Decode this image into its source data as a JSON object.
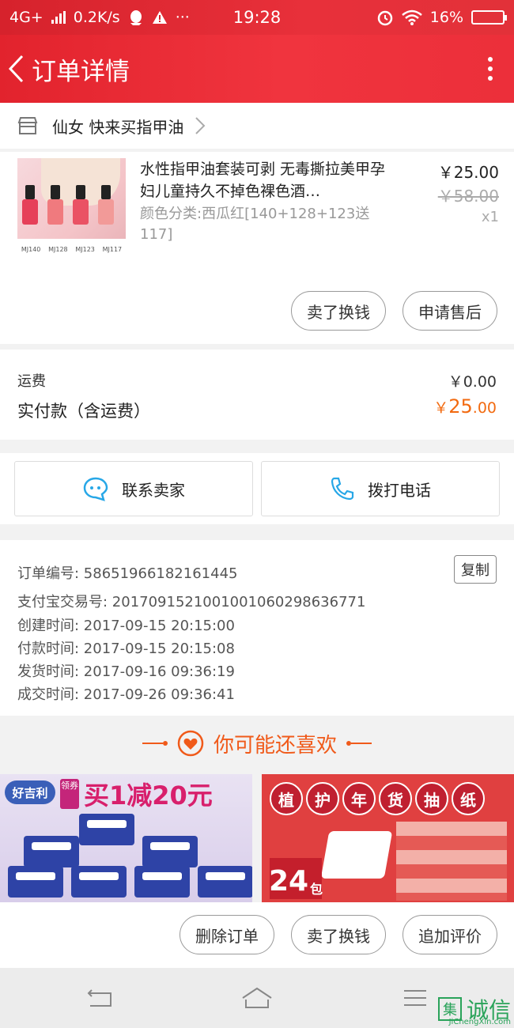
{
  "status_bar": {
    "network": "4G+",
    "speed": "0.2K/s",
    "time": "19:28",
    "battery": "16%",
    "battery_level": 0.16
  },
  "header": {
    "title": "订单详情"
  },
  "shop": {
    "name": "仙女 快来买指甲油"
  },
  "product": {
    "title": "水性指甲油套装可剥 无毒撕拉美甲孕妇儿童持久不掉色裸色酒…",
    "sku": "颜色分类:西瓜红[140+128+123送117]",
    "price": "￥25.00",
    "original_price": "￥58.00",
    "quantity": "x1",
    "thumb_labels": [
      "MJ140",
      "MJ128",
      "MJ123",
      "MJ117"
    ],
    "actions": {
      "resell": "卖了换钱",
      "after_sale": "申请售后"
    }
  },
  "fees": {
    "shipping_label": "运费",
    "shipping_value": "￥0.00",
    "paid_label": "实付款（含运费）",
    "paid_currency": "￥",
    "paid_integer": "25",
    "paid_decimal": ".00"
  },
  "contact": {
    "seller": "联系卖家",
    "phone": "拨打电话"
  },
  "order_info": {
    "copy_label": "复制",
    "lines": [
      "订单编号: 58651966182161445",
      "支付宝交易号: 2017091521001001060298636771",
      "创建时间: 2017-09-15 20:15:00",
      "付款时间: 2017-09-15 20:15:08",
      "发货时间: 2017-09-16 09:36:19",
      "成交时间: 2017-09-26 09:36:41"
    ]
  },
  "recommend": {
    "title": "你可能还喜欢",
    "left": {
      "brand": "好吉利",
      "coupon": "领券",
      "promo": "买1减20元"
    },
    "right": {
      "slogan": [
        "植",
        "护",
        "年",
        "货",
        "抽",
        "纸"
      ],
      "count": "24",
      "unit": "包"
    }
  },
  "bottom_actions": {
    "delete": "删除订单",
    "resell": "卖了换钱",
    "review": "追加评价"
  },
  "watermark": {
    "char": "集",
    "text": "诚信",
    "url": "JiChengXin.com"
  },
  "colors": {
    "header_red": "#e8303a",
    "price_orange": "#f26a10",
    "accent": "#f05a1a"
  }
}
